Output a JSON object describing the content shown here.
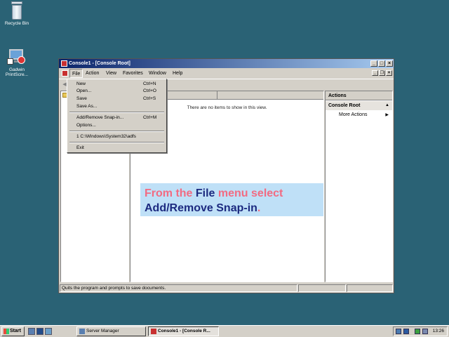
{
  "desktop": {
    "icons": [
      {
        "label": "Recycle Bin",
        "icon": "recycle-bin-icon"
      },
      {
        "label": "Gadwin PrintScre...",
        "icon": "gadwin-printscreen-icon"
      }
    ]
  },
  "window": {
    "title": "Console1 - [Console Root]",
    "menu": [
      "File",
      "Action",
      "View",
      "Favorites",
      "Window",
      "Help"
    ],
    "list_empty_message": "There are no items to show in this view.",
    "actions": {
      "title": "Actions",
      "group": "Console Root",
      "more": "More Actions"
    },
    "status": "Quits the program and prompts to save documents."
  },
  "file_menu": {
    "items": [
      {
        "label": "New",
        "shortcut": "Ctrl+N"
      },
      {
        "label": "Open...",
        "shortcut": "Ctrl+O"
      },
      {
        "label": "Save",
        "shortcut": "Ctrl+S"
      },
      {
        "label": "Save As...",
        "shortcut": ""
      },
      {
        "label": "Add/Remove Snap-in...",
        "shortcut": "Ctrl+M"
      },
      {
        "label": "Options...",
        "shortcut": ""
      },
      {
        "label": "1 C:\\Windows\\System32\\adfs",
        "shortcut": ""
      },
      {
        "label": "Exit",
        "shortcut": ""
      }
    ]
  },
  "callout": {
    "part1": "From the ",
    "part2": "File",
    "part3": " menu select",
    "part4": "Add/Remove Snap-in",
    "part5": "."
  },
  "taskbar": {
    "start": "Start",
    "tasks": [
      "Server Manager",
      "Console1 - [Console R..."
    ],
    "clock": "13:26"
  },
  "colors": {
    "desktop": "#2a6275",
    "callout_bg": "#bfe0f7",
    "callout_pink": "#f26b82",
    "callout_blue": "#1c2a80"
  }
}
